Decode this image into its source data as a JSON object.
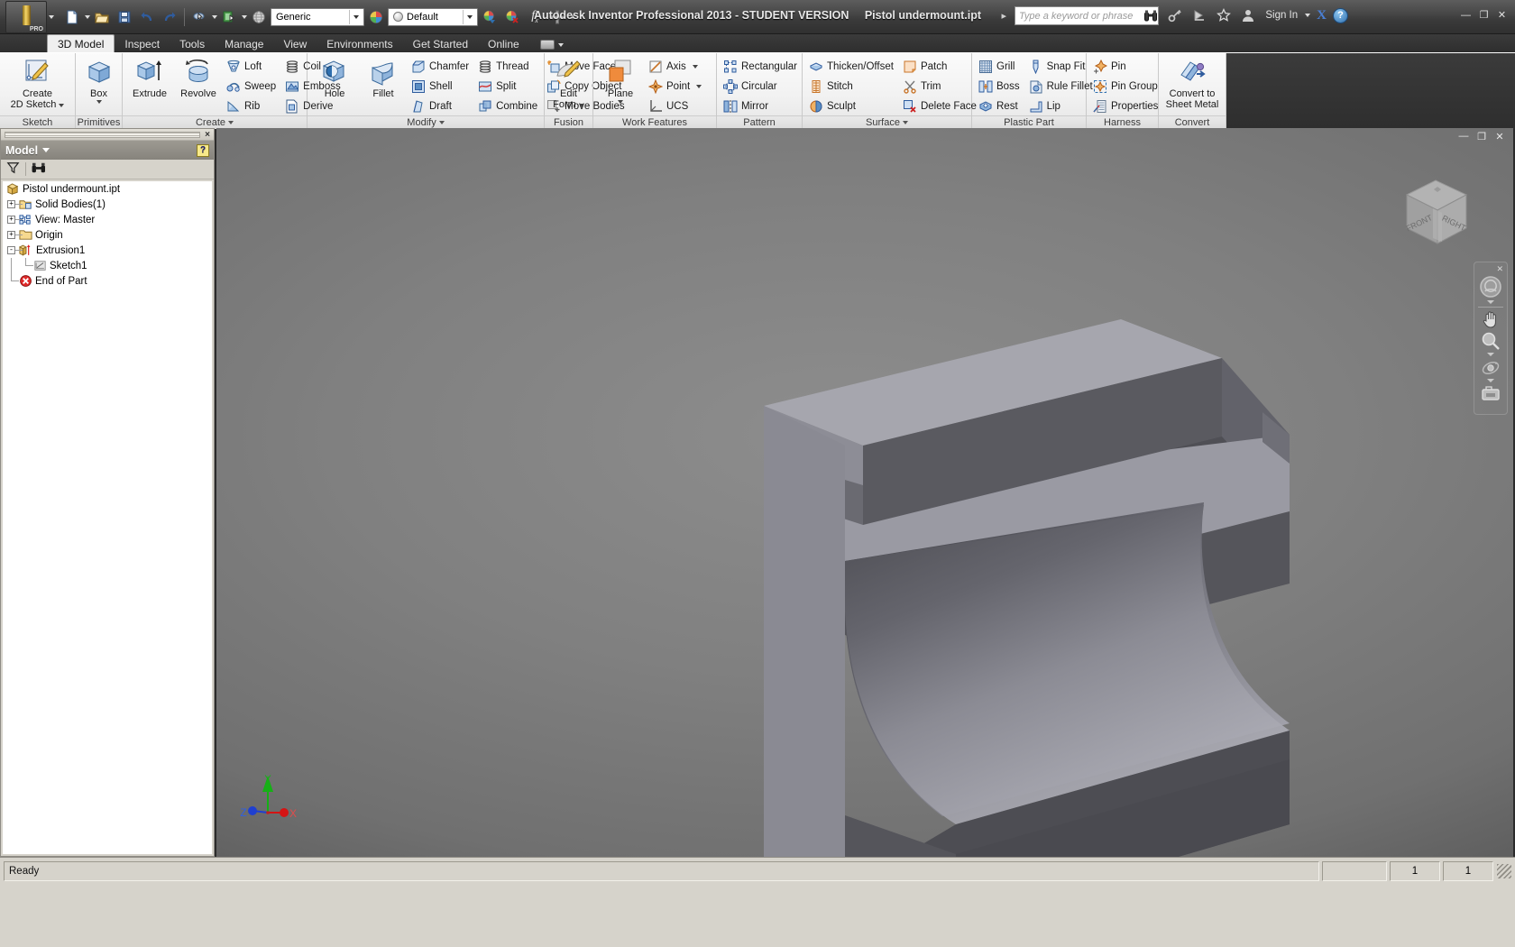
{
  "titlebar": {
    "app_title": "Autodesk Inventor Professional 2013 - STUDENT VERSION",
    "document_name": "Pistol undermount.ipt",
    "search_placeholder": "Type a keyword or phrase",
    "sign_in": "Sign In",
    "logo_text": "PRO",
    "material_combo": "Generic",
    "appearance_combo": "Default",
    "help_glyph": "?",
    "minimize": "—",
    "maximize": "❐",
    "close": "✕"
  },
  "tabs": [
    {
      "label": "3D Model",
      "active": true
    },
    {
      "label": "Inspect",
      "active": false
    },
    {
      "label": "Tools",
      "active": false
    },
    {
      "label": "Manage",
      "active": false
    },
    {
      "label": "View",
      "active": false
    },
    {
      "label": "Environments",
      "active": false
    },
    {
      "label": "Get Started",
      "active": false
    },
    {
      "label": "Online",
      "active": false
    }
  ],
  "ribbon": {
    "panels": [
      {
        "title": "Sketch",
        "big": [
          {
            "label1": "Create",
            "label2": "2D Sketch",
            "icon": "sketch-icon",
            "dropdown": true
          }
        ],
        "small": []
      },
      {
        "title": "Primitives",
        "big": [
          {
            "label1": "Box",
            "label2": "",
            "icon": "box-icon",
            "dropdown": true
          }
        ],
        "small": []
      },
      {
        "title": "Create",
        "title_arrow": true,
        "big": [
          {
            "label1": "Extrude",
            "label2": "",
            "icon": "extrude-icon",
            "dropdown": false
          },
          {
            "label1": "Revolve",
            "label2": "",
            "icon": "revolve-icon",
            "dropdown": false
          }
        ],
        "small": [
          [
            "Loft",
            "Sweep",
            "Rib"
          ],
          [
            "Coil",
            "Emboss",
            "Derive"
          ]
        ]
      },
      {
        "title": "Modify",
        "title_arrow": true,
        "big": [
          {
            "label1": "Hole",
            "label2": "",
            "icon": "hole-icon",
            "dropdown": false
          },
          {
            "label1": "Fillet",
            "label2": "",
            "icon": "fillet-icon",
            "dropdown": false
          }
        ],
        "small": [
          [
            "Chamfer",
            "Shell",
            "Draft"
          ],
          [
            "Thread",
            "Split",
            "Combine"
          ],
          [
            "Move Face",
            "Copy Object",
            "Move Bodies"
          ]
        ]
      },
      {
        "title": "Fusion",
        "big": [
          {
            "label1": "Edit",
            "label2": "Form",
            "icon": "edit-form-icon",
            "dropdown": true
          }
        ],
        "small": []
      },
      {
        "title": "Work Features",
        "big": [
          {
            "label1": "Plane",
            "label2": "",
            "icon": "plane-icon",
            "dropdown": true
          }
        ],
        "small": [
          [
            "Axis",
            "Point",
            "UCS"
          ]
        ],
        "small_arrows": [
          true,
          true,
          false
        ]
      },
      {
        "title": "Pattern",
        "big": [],
        "small": [
          [
            "Rectangular",
            "Circular",
            "Mirror"
          ]
        ]
      },
      {
        "title": "Surface",
        "title_arrow": true,
        "big": [],
        "small": [
          [
            "Thicken/Offset",
            "Stitch",
            "Sculpt"
          ],
          [
            "Patch",
            "Trim",
            "Delete Face"
          ]
        ]
      },
      {
        "title": "Plastic Part",
        "big": [],
        "small": [
          [
            "Grill",
            "Boss",
            "Rest"
          ],
          [
            "Snap Fit",
            "Rule Fillet",
            "Lip"
          ]
        ]
      },
      {
        "title": "Harness",
        "big": [],
        "small": [
          [
            "Pin",
            "Pin Group",
            "Properties"
          ]
        ]
      },
      {
        "title": "Convert",
        "big": [
          {
            "label1": "Convert to",
            "label2": "Sheet Metal",
            "icon": "convert-sheetmetal-icon",
            "dropdown": false
          }
        ],
        "small": []
      }
    ]
  },
  "browser": {
    "panel_title": "Model",
    "help_badge": "?",
    "filter_tooltip": "filter-icon",
    "find_tooltip": "find-icon",
    "tree": [
      {
        "label": "Pistol undermount.ipt",
        "depth": 0,
        "expander": "",
        "icon": "part-icon"
      },
      {
        "label": "Solid Bodies(1)",
        "depth": 1,
        "expander": "+",
        "icon": "solid-bodies-icon"
      },
      {
        "label": "View: Master",
        "depth": 1,
        "expander": "+",
        "icon": "view-master-icon"
      },
      {
        "label": "Origin",
        "depth": 1,
        "expander": "+",
        "icon": "folder-icon"
      },
      {
        "label": "Extrusion1",
        "depth": 1,
        "expander": "-",
        "icon": "extrusion-icon"
      },
      {
        "label": "Sketch1",
        "depth": 2,
        "expander": "",
        "icon": "sketch-node-icon"
      },
      {
        "label": "End of Part",
        "depth": 1,
        "expander": "",
        "icon": "end-of-part-icon"
      }
    ]
  },
  "viewport": {
    "viewcube_front": "FRONT",
    "viewcube_right": "RIGHT",
    "triad_x": "X",
    "triad_y": "Y",
    "triad_z": "Z",
    "nav_close": "✕",
    "win_min": "—",
    "win_restore": "❐",
    "win_close": "✕",
    "nav_tools": [
      "steering-wheel-icon",
      "pan-hand-icon",
      "zoom-magnifier-icon",
      "orbit-icon",
      "look-at-icon"
    ]
  },
  "statusbar": {
    "message": "Ready",
    "cell1": "1",
    "cell2": "1"
  },
  "colors": {
    "accent_blue": "#4a7fd4",
    "ribbon_bg": "#f2f2f2",
    "browser_bg": "#d6d3cb",
    "viewport_bg": "#808080",
    "model_face_light": "#9a9aa0",
    "model_face_mid": "#7c7c84",
    "model_face_dark": "#545459"
  }
}
